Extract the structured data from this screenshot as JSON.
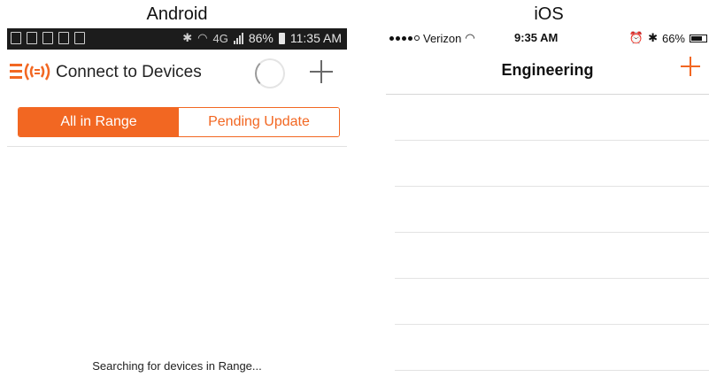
{
  "labels": {
    "android": "Android",
    "ios": "iOS"
  },
  "android": {
    "status_bar": {
      "battery": "86%",
      "time": "11:35 AM",
      "network": "4G"
    },
    "app_bar": {
      "title": "Connect to Devices"
    },
    "tabs": [
      {
        "label": "All in Range",
        "selected": true
      },
      {
        "label": "Pending Update",
        "selected": false
      }
    ],
    "status_message": "Searching for devices in Range...",
    "accent_color": "#f26722"
  },
  "ios": {
    "status_bar": {
      "carrier": "Verizon",
      "time": "9:35 AM",
      "battery": "66%"
    },
    "nav_bar": {
      "title": "Engineering"
    },
    "list_rows": 6,
    "accent_color": "#f26722"
  }
}
